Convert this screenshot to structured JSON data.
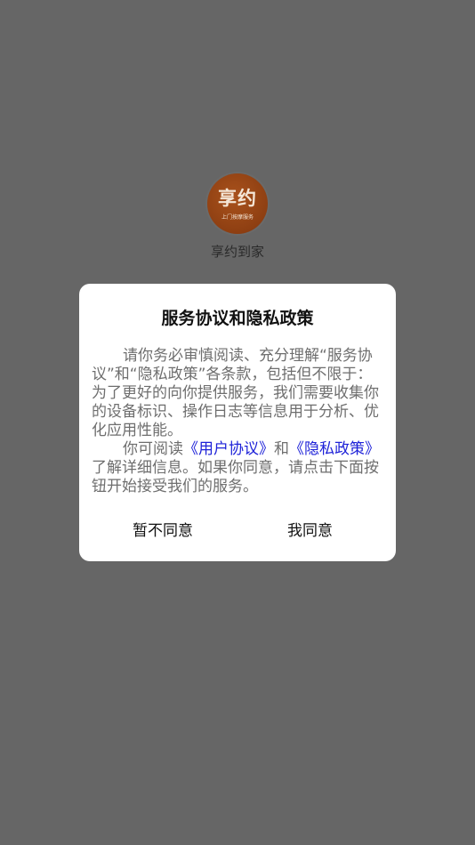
{
  "app": {
    "name": "享约到家",
    "logo": {
      "main_text": "享约",
      "sub_text": "上门按摩服务",
      "color": "#8e3f12"
    }
  },
  "dialog": {
    "title": "服务协议和隐私政策",
    "paragraph1": "请你务必审慎阅读、充分理解“服务协议”和“隐私政策”各条款，包括但不限于：为了更好的向你提供服务，我们需要收集你的设备标识、操作日志等信息用于分析、优化应用性能。",
    "paragraph2_prefix": "你可阅读",
    "user_agreement_link": "《用户协议》",
    "and_text": "和",
    "privacy_policy_link": "《隐私政策》",
    "paragraph2_suffix": "了解详细信息。如果你同意，请点击下面按钮开始接受我们的服务。",
    "disagree_label": "暂不同意",
    "agree_label": "我同意",
    "link_color": "#1e22d8"
  },
  "colors": {
    "overlay": "#666666",
    "dialog_bg": "#ffffff"
  }
}
